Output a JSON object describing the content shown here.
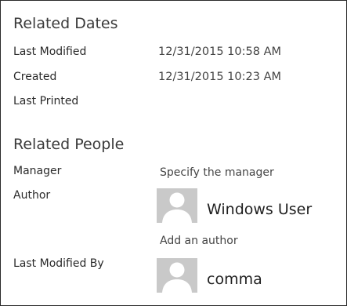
{
  "related_dates": {
    "title": "Related Dates",
    "last_modified_label": "Last Modified",
    "last_modified_value": "12/31/2015 10:58 AM",
    "created_label": "Created",
    "created_value": "12/31/2015 10:23 AM",
    "last_printed_label": "Last Printed"
  },
  "related_people": {
    "title": "Related People",
    "manager_label": "Manager",
    "manager_link": "Specify the manager",
    "author_label": "Author",
    "author_name": "Windows User",
    "add_author_link": "Add an author",
    "last_modified_by_label": "Last Modified By",
    "last_modified_by_name": "comma"
  },
  "icons": {
    "avatar": "person-silhouette-icon"
  },
  "colors": {
    "avatar_bg": "#c9c9c9",
    "avatar_silhouette": "#ffffff"
  }
}
